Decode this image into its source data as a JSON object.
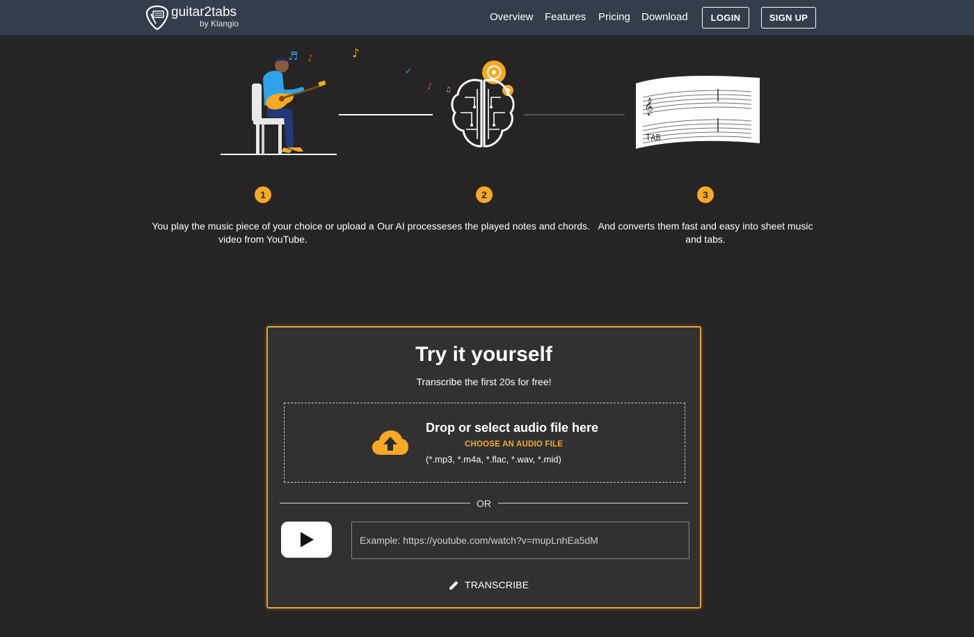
{
  "brand": {
    "name": "guitar2tabs",
    "byline": "by Klangio"
  },
  "nav": {
    "links": [
      "Overview",
      "Features",
      "Pricing",
      "Download"
    ],
    "login": "LOGIN",
    "signup": "SIGN UP"
  },
  "steps": [
    {
      "number": "1",
      "text": "You play the music piece of your choice or upload a video from YouTube."
    },
    {
      "number": "2",
      "text": "Our AI processeses the played notes and chords."
    },
    {
      "number": "3",
      "text": "And converts them fast and easy into sheet music and tabs."
    }
  ],
  "card": {
    "title": "Try it yourself",
    "subtitle": "Transcribe the first 20s for free!",
    "drop_title": "Drop or select audio file here",
    "choose_label": "CHOOSE AN AUDIO FILE",
    "formats": "(*.mp3, *.m4a, *.flac, *.wav, *.mid)",
    "or_label": "OR",
    "url_value": "",
    "url_placeholder": "Example: https://youtube.com/watch?v=mupLnhEa5dM",
    "transcribe_label": "TRANSCRIBE"
  },
  "colors": {
    "background": "#262424",
    "navbar": "#343d4b",
    "accent": "#f6a925",
    "card": "#323030",
    "card_border": "#e8a33a"
  },
  "icons": [
    "guitar-pick-logo-icon",
    "upload-cloud-icon",
    "youtube-play-icon",
    "pencil-icon"
  ]
}
